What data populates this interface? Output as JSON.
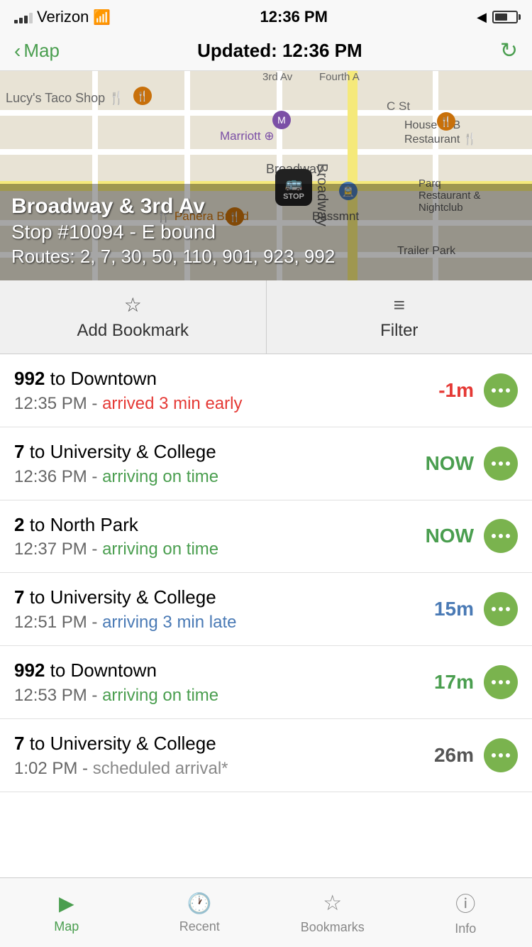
{
  "statusBar": {
    "carrier": "Verizon",
    "time": "12:36 PM"
  },
  "navBar": {
    "backLabel": "Map",
    "title": "Updated: 12:36 PM",
    "refreshIcon": "↻"
  },
  "mapOverlay": {
    "stopName": "Broadway & 3rd Av",
    "stopNumber": "Stop #10094 - E bound",
    "stopRoutes": "Routes: 2, 7, 30, 50, 110, 901, 923, 992"
  },
  "mapLabels": {
    "tacoshop": "Lucy's Taco Shop",
    "marriott": "Marriott",
    "broadway": "Broadway",
    "panera": "Panera Bread",
    "bassmnt": "Bassmnt",
    "houseofb": "House of B Restaurant",
    "parq": "Parq Restaurant & Nightclub",
    "trailerpark": "Trailer Park"
  },
  "actions": {
    "bookmark": {
      "label": "Add Bookmark",
      "icon": "☆"
    },
    "filter": {
      "label": "Filter",
      "icon": "≡"
    }
  },
  "busList": [
    {
      "route": "992",
      "destination": "to Downtown",
      "time": "12:35 PM",
      "statusText": "arrived 3 min early",
      "statusClass": "status-early",
      "badgeText": "-1m",
      "badgeClass": "badge-red"
    },
    {
      "route": "7",
      "destination": "to University & College",
      "time": "12:36 PM",
      "statusText": "arriving on time",
      "statusClass": "status-ontime",
      "badgeText": "NOW",
      "badgeClass": "badge-green"
    },
    {
      "route": "2",
      "destination": "to North Park",
      "time": "12:37 PM",
      "statusText": "arriving on time",
      "statusClass": "status-ontime",
      "badgeText": "NOW",
      "badgeClass": "badge-green"
    },
    {
      "route": "7",
      "destination": "to University & College",
      "time": "12:51 PM",
      "statusText": "arriving 3 min late",
      "statusClass": "status-late",
      "badgeText": "15m",
      "badgeClass": "badge-blue"
    },
    {
      "route": "992",
      "destination": "to Downtown",
      "time": "12:53 PM",
      "statusText": "arriving on time",
      "statusClass": "status-ontime",
      "badgeText": "17m",
      "badgeClass": "badge-green"
    },
    {
      "route": "7",
      "destination": "to University & College",
      "time": "1:02 PM",
      "statusText": "scheduled arrival*",
      "statusClass": "status-scheduled",
      "badgeText": "26m",
      "badgeClass": "badge-gray"
    }
  ],
  "tabBar": {
    "tabs": [
      {
        "label": "Map",
        "icon": "▲",
        "active": true
      },
      {
        "label": "Recent",
        "icon": "🕐",
        "active": false
      },
      {
        "label": "Bookmarks",
        "icon": "☆",
        "active": false
      },
      {
        "label": "Info",
        "icon": "ⓘ",
        "active": false
      }
    ]
  }
}
